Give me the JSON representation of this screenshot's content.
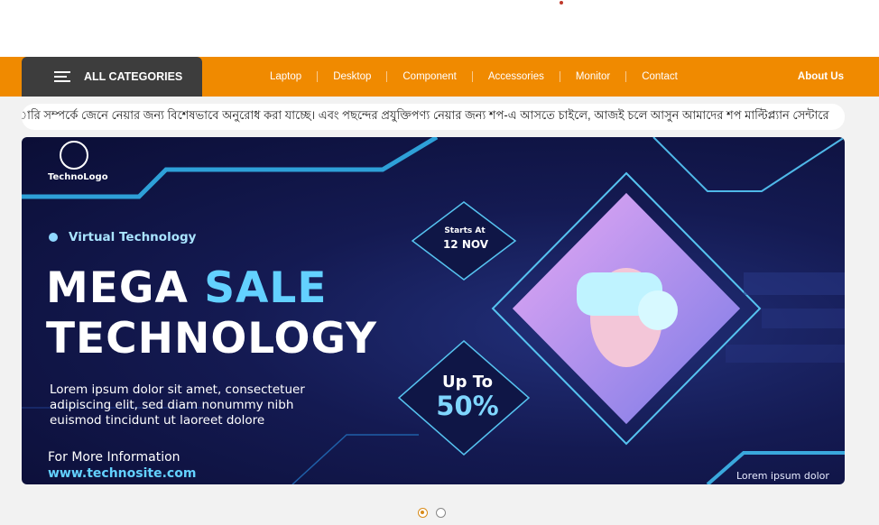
{
  "nav": {
    "all_categories": "ALL CATEGORIES",
    "links": [
      "Laptop",
      "Desktop",
      "Component",
      "Accessories",
      "Monitor",
      "Contact"
    ],
    "about": "About Us"
  },
  "marquee": {
    "text": "ারি সম্পর্কে জেনে নেয়ার জন্য বিশেষভাবে অনুরোধ করা যাচ্ছে। এবং পছন্দের প্রযুক্তিপণ্য নেয়ার জন্য শপ-এ আসতে চাইলে, আজই চলে আসুন আমাদের শপ মাল্টিপ্ল্যান সেন্টারে"
  },
  "banner": {
    "logo": "TechnoLogo",
    "tag": "Virtual Technology",
    "headline_a": "MEGA ",
    "headline_b": "SALE",
    "headline_2": "TECHNOLOGY",
    "body": "Lorem ipsum dolor sit amet, consectetuer adipiscing elit, sed diam nonummy nibh euismod tincidunt ut laoreet dolore",
    "more_info": "For More Information",
    "site": "www.technosite.com",
    "starts_label": "Starts At",
    "starts_date": "12 NOV",
    "upto_label": "Up To",
    "upto_value": "50%",
    "corner_text": "Lorem ipsum dolor"
  },
  "carousel": {
    "slides": 2,
    "active": 1
  },
  "colors": {
    "nav": "#f08a00",
    "category": "#3d3d3d",
    "accent": "#63d1ff"
  }
}
